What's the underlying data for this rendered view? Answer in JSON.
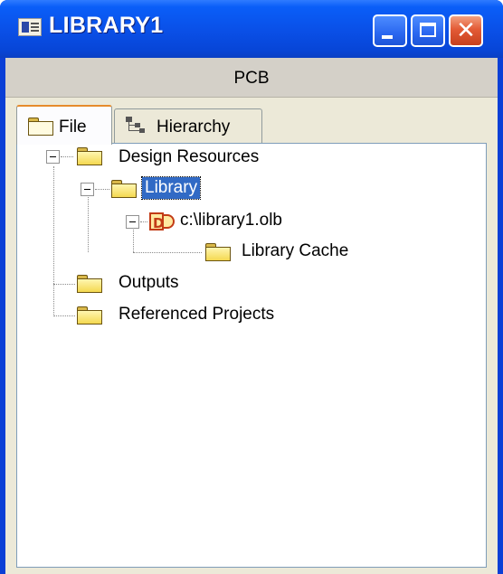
{
  "window": {
    "title": "LIBRARY1",
    "icons": {
      "app": "library-window-icon",
      "minimize": "minimize-icon",
      "maximize": "maximize-icon",
      "close": "close-icon"
    },
    "colors": {
      "titlebar": "#0a4fe6",
      "close_button": "#e35b36",
      "selection": "#316ac5",
      "client_bg": "#ece9d8"
    }
  },
  "header": {
    "label": "PCB"
  },
  "tabs": [
    {
      "label": "File",
      "icon": "folder-icon",
      "active": true
    },
    {
      "label": "Hierarchy",
      "icon": "hierarchy-icon",
      "active": false
    }
  ],
  "tree": {
    "design_resources": {
      "label": "Design Resources",
      "icon": "folder-icon",
      "expanded": true
    },
    "library": {
      "label": "Library",
      "icon": "folder-icon",
      "expanded": true,
      "selected": true
    },
    "library_file": {
      "label": "c:\\library1.olb",
      "icon": "library-file-icon",
      "expanded": true
    },
    "library_cache": {
      "label": "Library Cache",
      "icon": "folder-icon"
    },
    "outputs": {
      "label": "Outputs",
      "icon": "folder-icon"
    },
    "referenced_projects": {
      "label": "Referenced Projects",
      "icon": "folder-icon"
    }
  }
}
